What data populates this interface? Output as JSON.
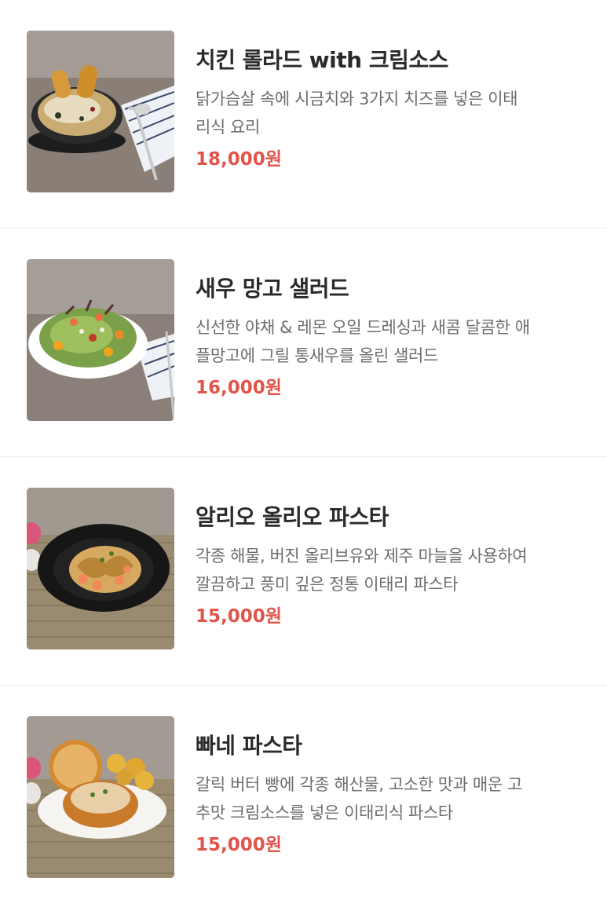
{
  "menu": {
    "items": [
      {
        "name": "치킨 롤라드 with 크림소스",
        "desc_line1": "닭가슴살 속에 시금치와 3가지 치즈를 넣은 이태",
        "desc_line2": "리식 요리",
        "price": "18,000원",
        "image": "chicken-roulade-photo"
      },
      {
        "name": "새우 망고 샐러드",
        "desc_line1": "신선한 야채 & 레몬 오일 드레싱과 새콤 달콤한 애",
        "desc_line2": "플망고에 그릴 통새우를 올린 샐러드",
        "price": "16,000원",
        "image": "shrimp-mango-salad-photo"
      },
      {
        "name": "알리오 올리오 파스타",
        "desc_line1": "각종 해물, 버진 올리브유와 제주 마늘을 사용하여",
        "desc_line2": "깔끔하고 풍미 깊은 정통 이태리 파스타",
        "price": "15,000원",
        "image": "aglio-olio-pasta-photo"
      },
      {
        "name": "빠네 파스타",
        "desc_line1": "갈릭 버터 빵에 각종 해산물, 고소한 맛과 매운 고",
        "desc_line2": "추맛 크림소스를 넣은 이태리식 파스타",
        "price": "15,000원",
        "image": "pane-pasta-photo"
      }
    ],
    "colors": {
      "price": "#e0554b",
      "title": "#2a2a2a",
      "description": "#6d6d6d",
      "divider": "#ececec"
    }
  }
}
